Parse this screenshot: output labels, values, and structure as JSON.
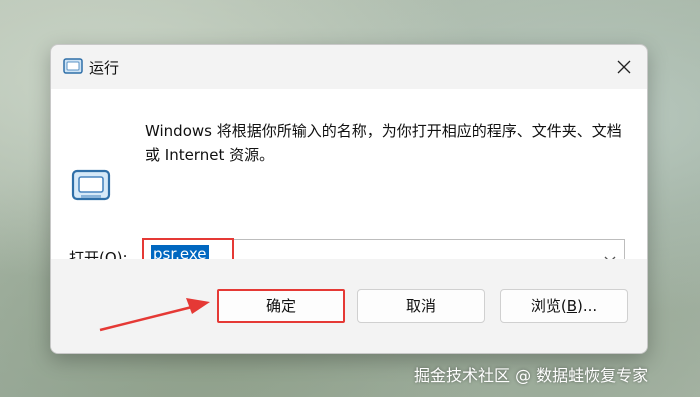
{
  "window": {
    "title": "运行",
    "title_icon": "run-app-icon",
    "close_icon": "close-icon"
  },
  "content": {
    "app_icon": "run-program-icon",
    "description": "Windows 将根据你所输入的名称，为你打开相应的程序、文件夹、文档或 Internet 资源。",
    "open_label_prefix": "打开(",
    "open_label_key": "O",
    "open_label_suffix": "):",
    "open_value": "psr.exe",
    "dropdown_icon": "chevron-down-icon"
  },
  "buttons": {
    "ok": "确定",
    "cancel": "取消",
    "browse_prefix": "浏览(",
    "browse_key": "B",
    "browse_suffix": ")..."
  },
  "annotations": {
    "highlight_color": "#e53935"
  },
  "watermark": "掘金技术社区 @ 数据蛙恢复专家",
  "colors": {
    "accent": "#0067c0",
    "highlight": "#e53935"
  }
}
